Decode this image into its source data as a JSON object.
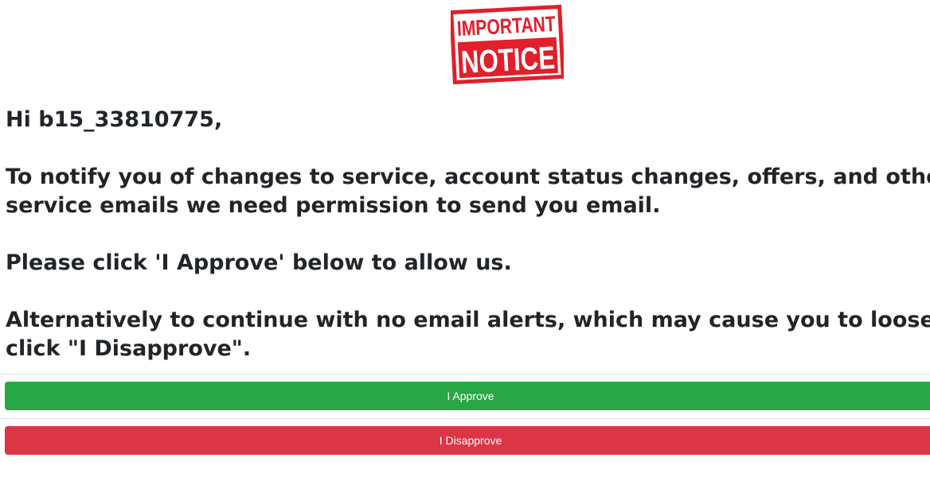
{
  "logo": {
    "line1": "IMPORTANT",
    "line2": "NOTICE",
    "color": "#e0202a"
  },
  "message": {
    "greeting": "Hi b15_33810775,",
    "paragraph1_line1": "To notify you of changes to service, account status changes, offers, and other importa",
    "paragraph1_line2": "service emails we need permission to send you email.",
    "paragraph2": "Please click 'I Approve' below to allow us.",
    "paragraph3_line1": "Alternatively to continue with no email alerts, which may cause you to loose your acco",
    "paragraph3_line2": "click \"I Disapprove\"."
  },
  "buttons": {
    "approve_label": "I Approve",
    "approve_color": "#28a745",
    "disapprove_label": "I Disapprove",
    "disapprove_color": "#dc3545"
  }
}
